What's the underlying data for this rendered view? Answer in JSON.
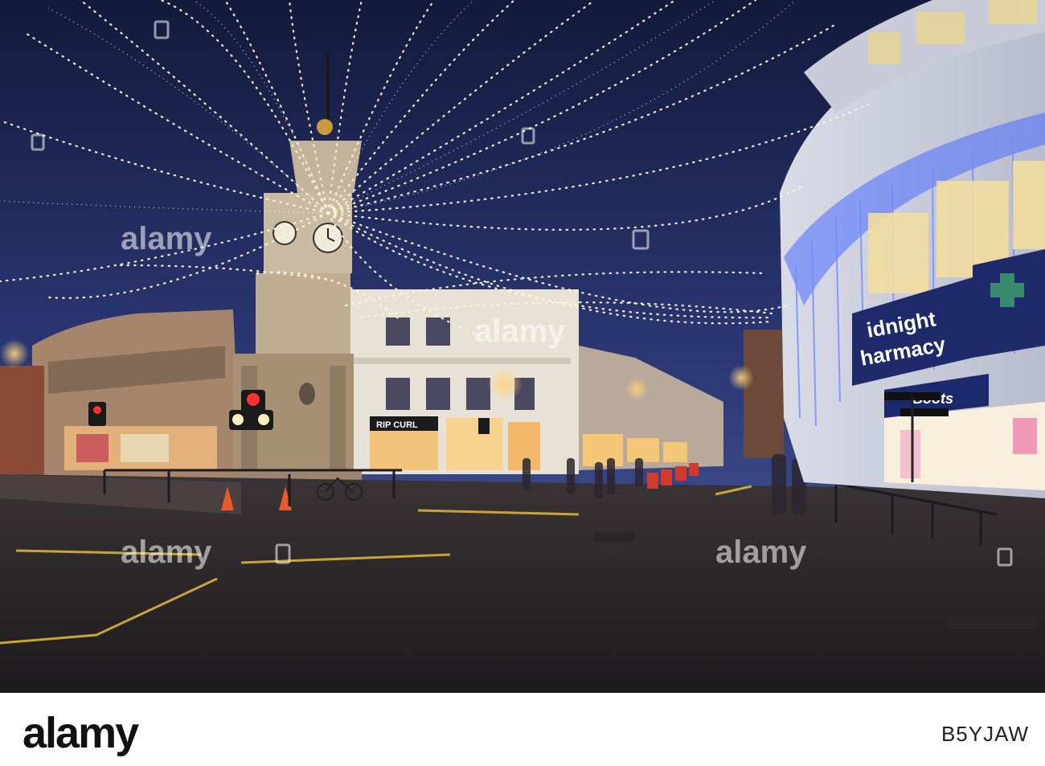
{
  "photo": {
    "sign_line1": "idnight",
    "sign_line2": "harmacy",
    "store_name": "Boots",
    "shop_sign": "RIP CURL",
    "sky_top": "#1c2349",
    "sky_bottom": "#3a4a86",
    "light_color": "#fff4d6",
    "blue_light_color": "#4a6cff"
  },
  "watermark": {
    "text": "alamy"
  },
  "footer": {
    "brand": "alamy",
    "image_id": "B5YJAW"
  }
}
